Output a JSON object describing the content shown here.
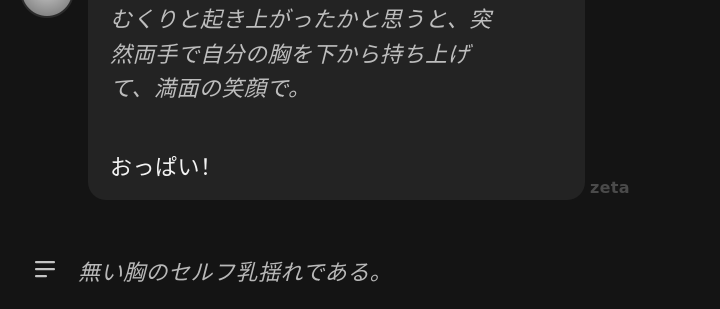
{
  "message": {
    "narration_lines": [
      "むくりと起き上がったかと思うと、突",
      "然両手で自分の胸を下から持ち上げ",
      "て、満面の笑顔で。"
    ],
    "speech": "おっぱい！",
    "watermark": "zeta"
  },
  "suggestion": {
    "icon": "menu-lines-icon",
    "text": "無い胸のセルフ乳揺れである。"
  },
  "colors": {
    "background": "#141414",
    "bubble": "#232323",
    "narration_text": "#bdbdbd",
    "speech_text": "#f2f2f2",
    "watermark": "#4a4a4a"
  }
}
